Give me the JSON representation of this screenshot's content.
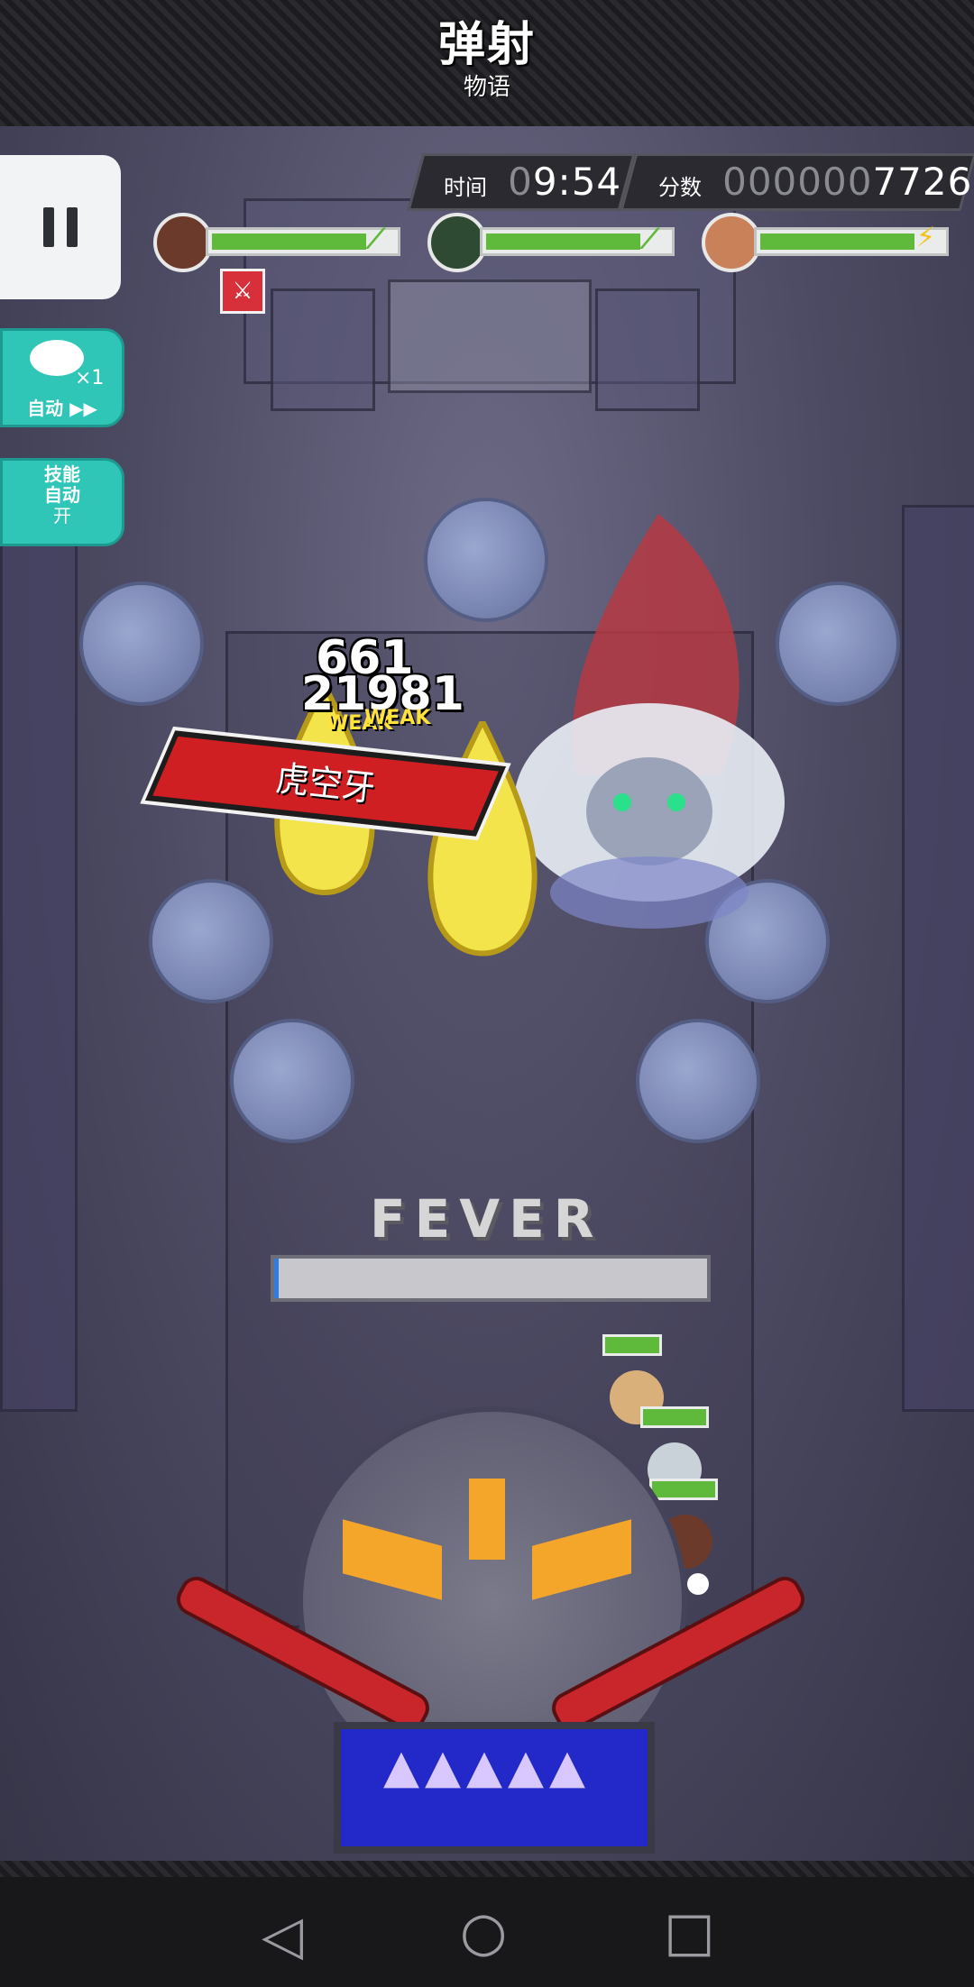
{
  "header": {
    "logo_main": "弹射",
    "logo_sub": "物语"
  },
  "hud": {
    "time_label": "时间",
    "time_prefix": "0",
    "time_value": "9:54",
    "score_label": "分数",
    "score_prefix": "000000",
    "score_value": "7726"
  },
  "party": [
    {
      "name": "character-1",
      "hp_fraction": 0.85,
      "skill": "leaf"
    },
    {
      "name": "character-2",
      "hp_fraction": 0.85,
      "skill": "leaf"
    },
    {
      "name": "character-3",
      "hp_fraction": 0.85,
      "skill": "lightning"
    }
  ],
  "side_buttons": {
    "auto_multiplier": "×1",
    "auto_label": "自动 ▶▶",
    "skill_auto_line1": "技能",
    "skill_auto_line2": "自动",
    "skill_auto_state": "开"
  },
  "battle": {
    "damage_1": "661",
    "damage_2": "21981",
    "weak_1": "WEAK",
    "weak_2": "WEAK",
    "skill_name": "虎空牙"
  },
  "fever": {
    "label": "FEVER",
    "fill_fraction": 0.01
  },
  "colors": {
    "hp_green": "#5fb93a",
    "accent_teal": "#2fc6b8",
    "flipper_red": "#c8262a",
    "skill_banner_red": "#d01f22"
  },
  "navbar": {
    "back_icon": "◁",
    "home_icon": "○",
    "recent_icon": "□"
  }
}
